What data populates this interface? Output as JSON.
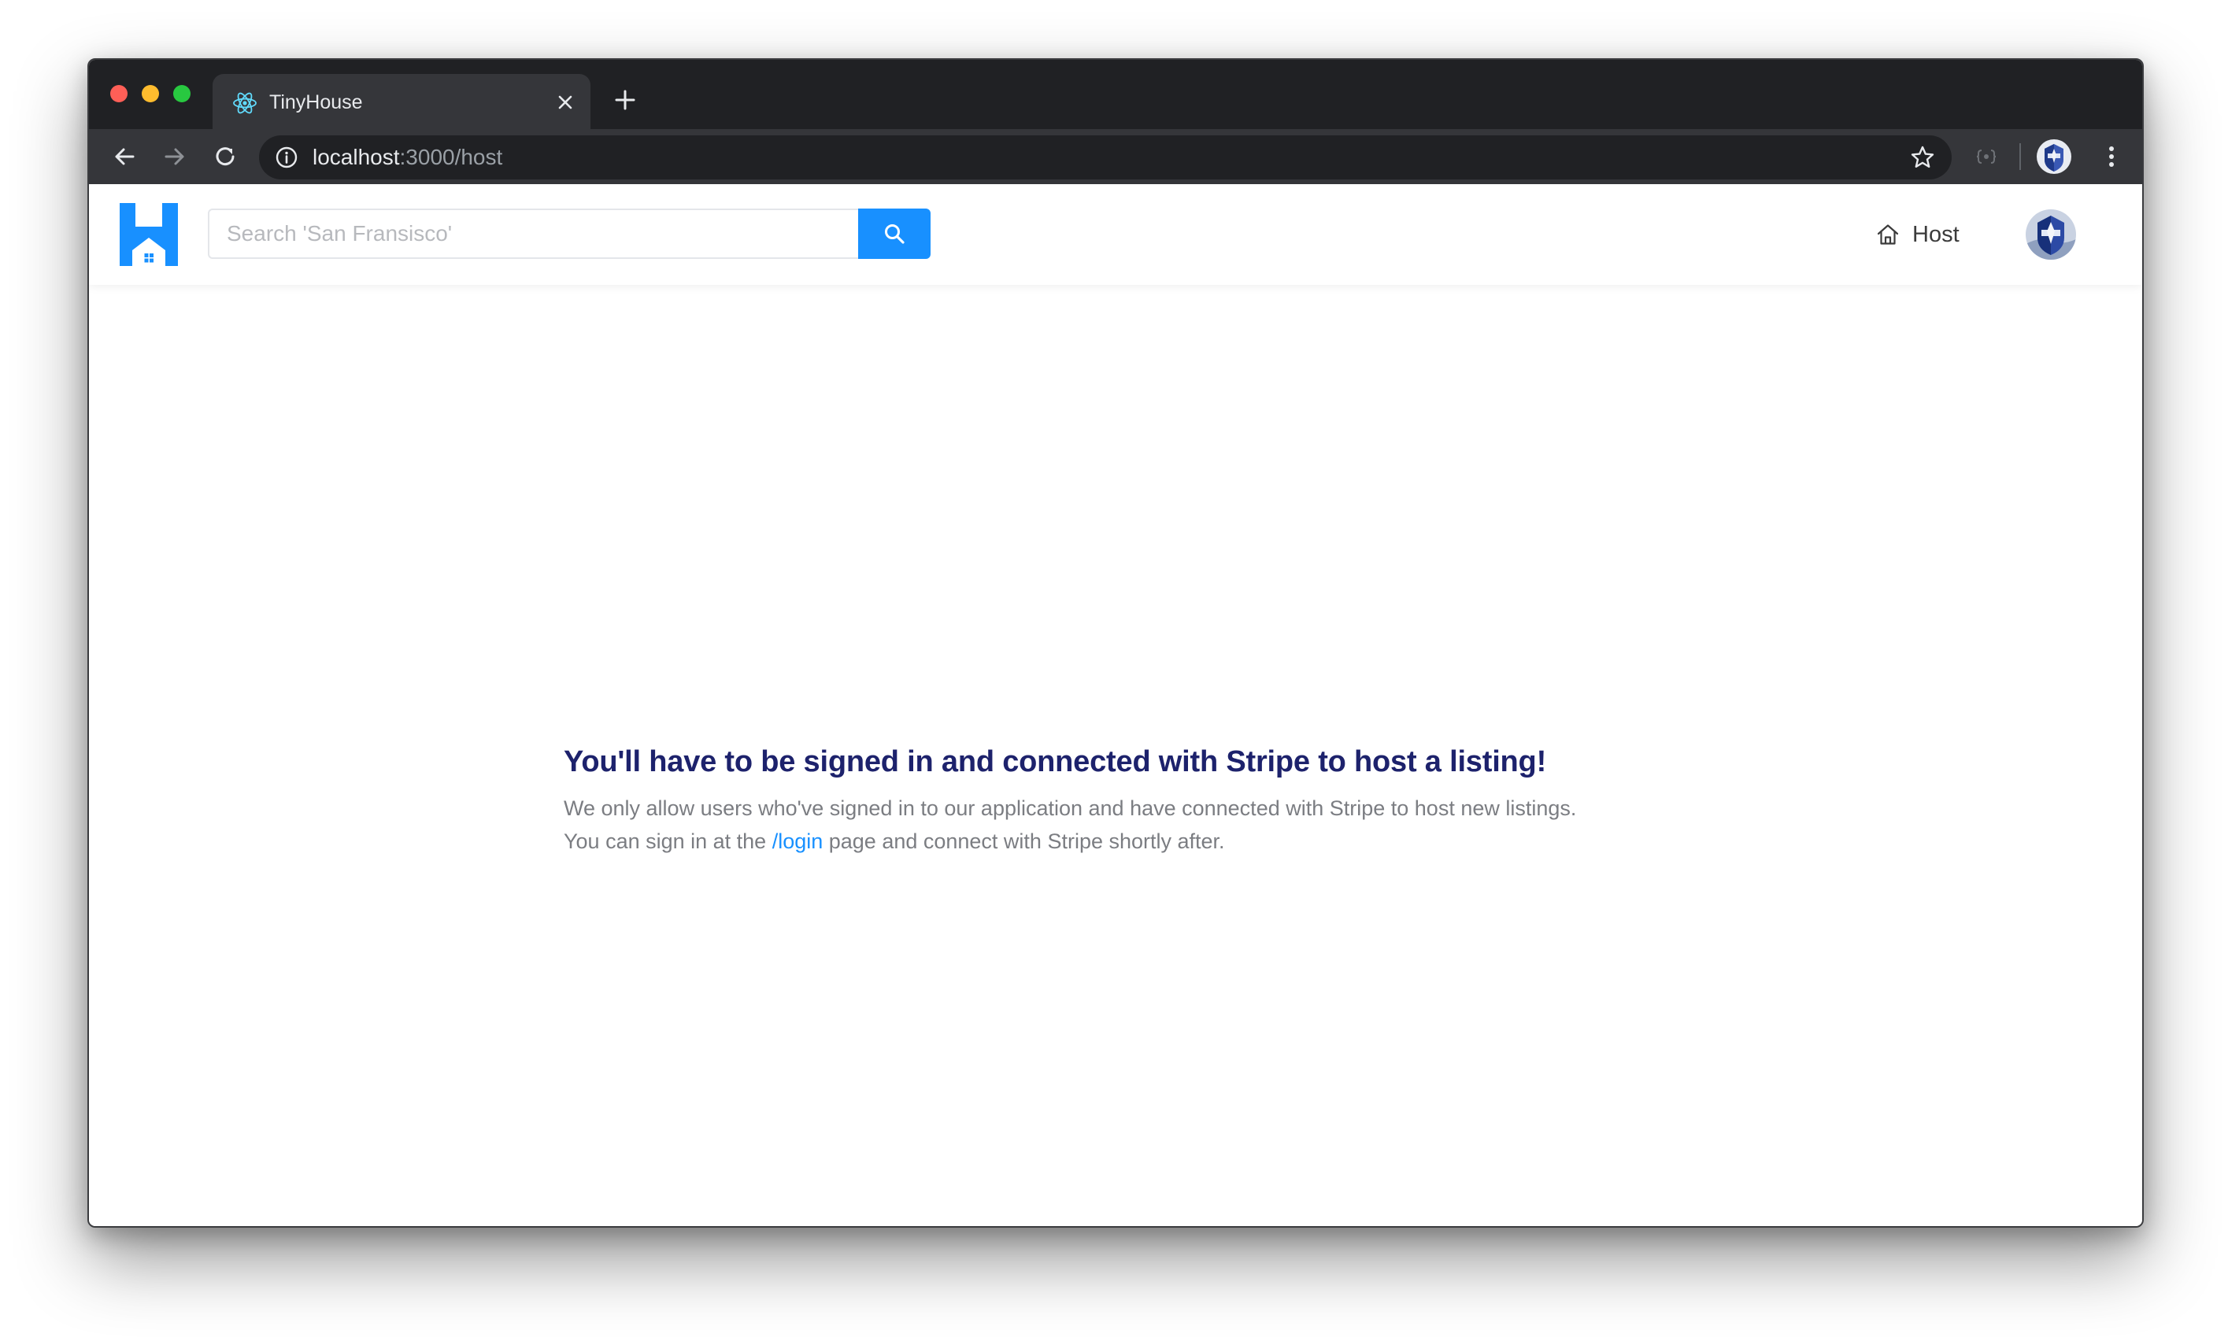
{
  "browser": {
    "tab": {
      "title": "TinyHouse",
      "favicon": "react-icon"
    },
    "address_bar": {
      "host": "localhost",
      "path": ":3000/host"
    }
  },
  "app": {
    "brand_color": "#1890ff",
    "search": {
      "placeholder": "Search 'San Fransisco'",
      "value": ""
    },
    "nav": {
      "host_label": "Host",
      "host_icon": "home-icon"
    }
  },
  "main": {
    "title": "You'll have to be signed in and connected with Stripe to host a listing!",
    "line1": "We only allow users who've signed in to our application and have connected with Stripe to host new listings.",
    "line2_before": "You can sign in at the ",
    "line2_link": "/login",
    "line2_after": " page and connect with Stripe shortly after.",
    "title_color": "#1d226c"
  }
}
